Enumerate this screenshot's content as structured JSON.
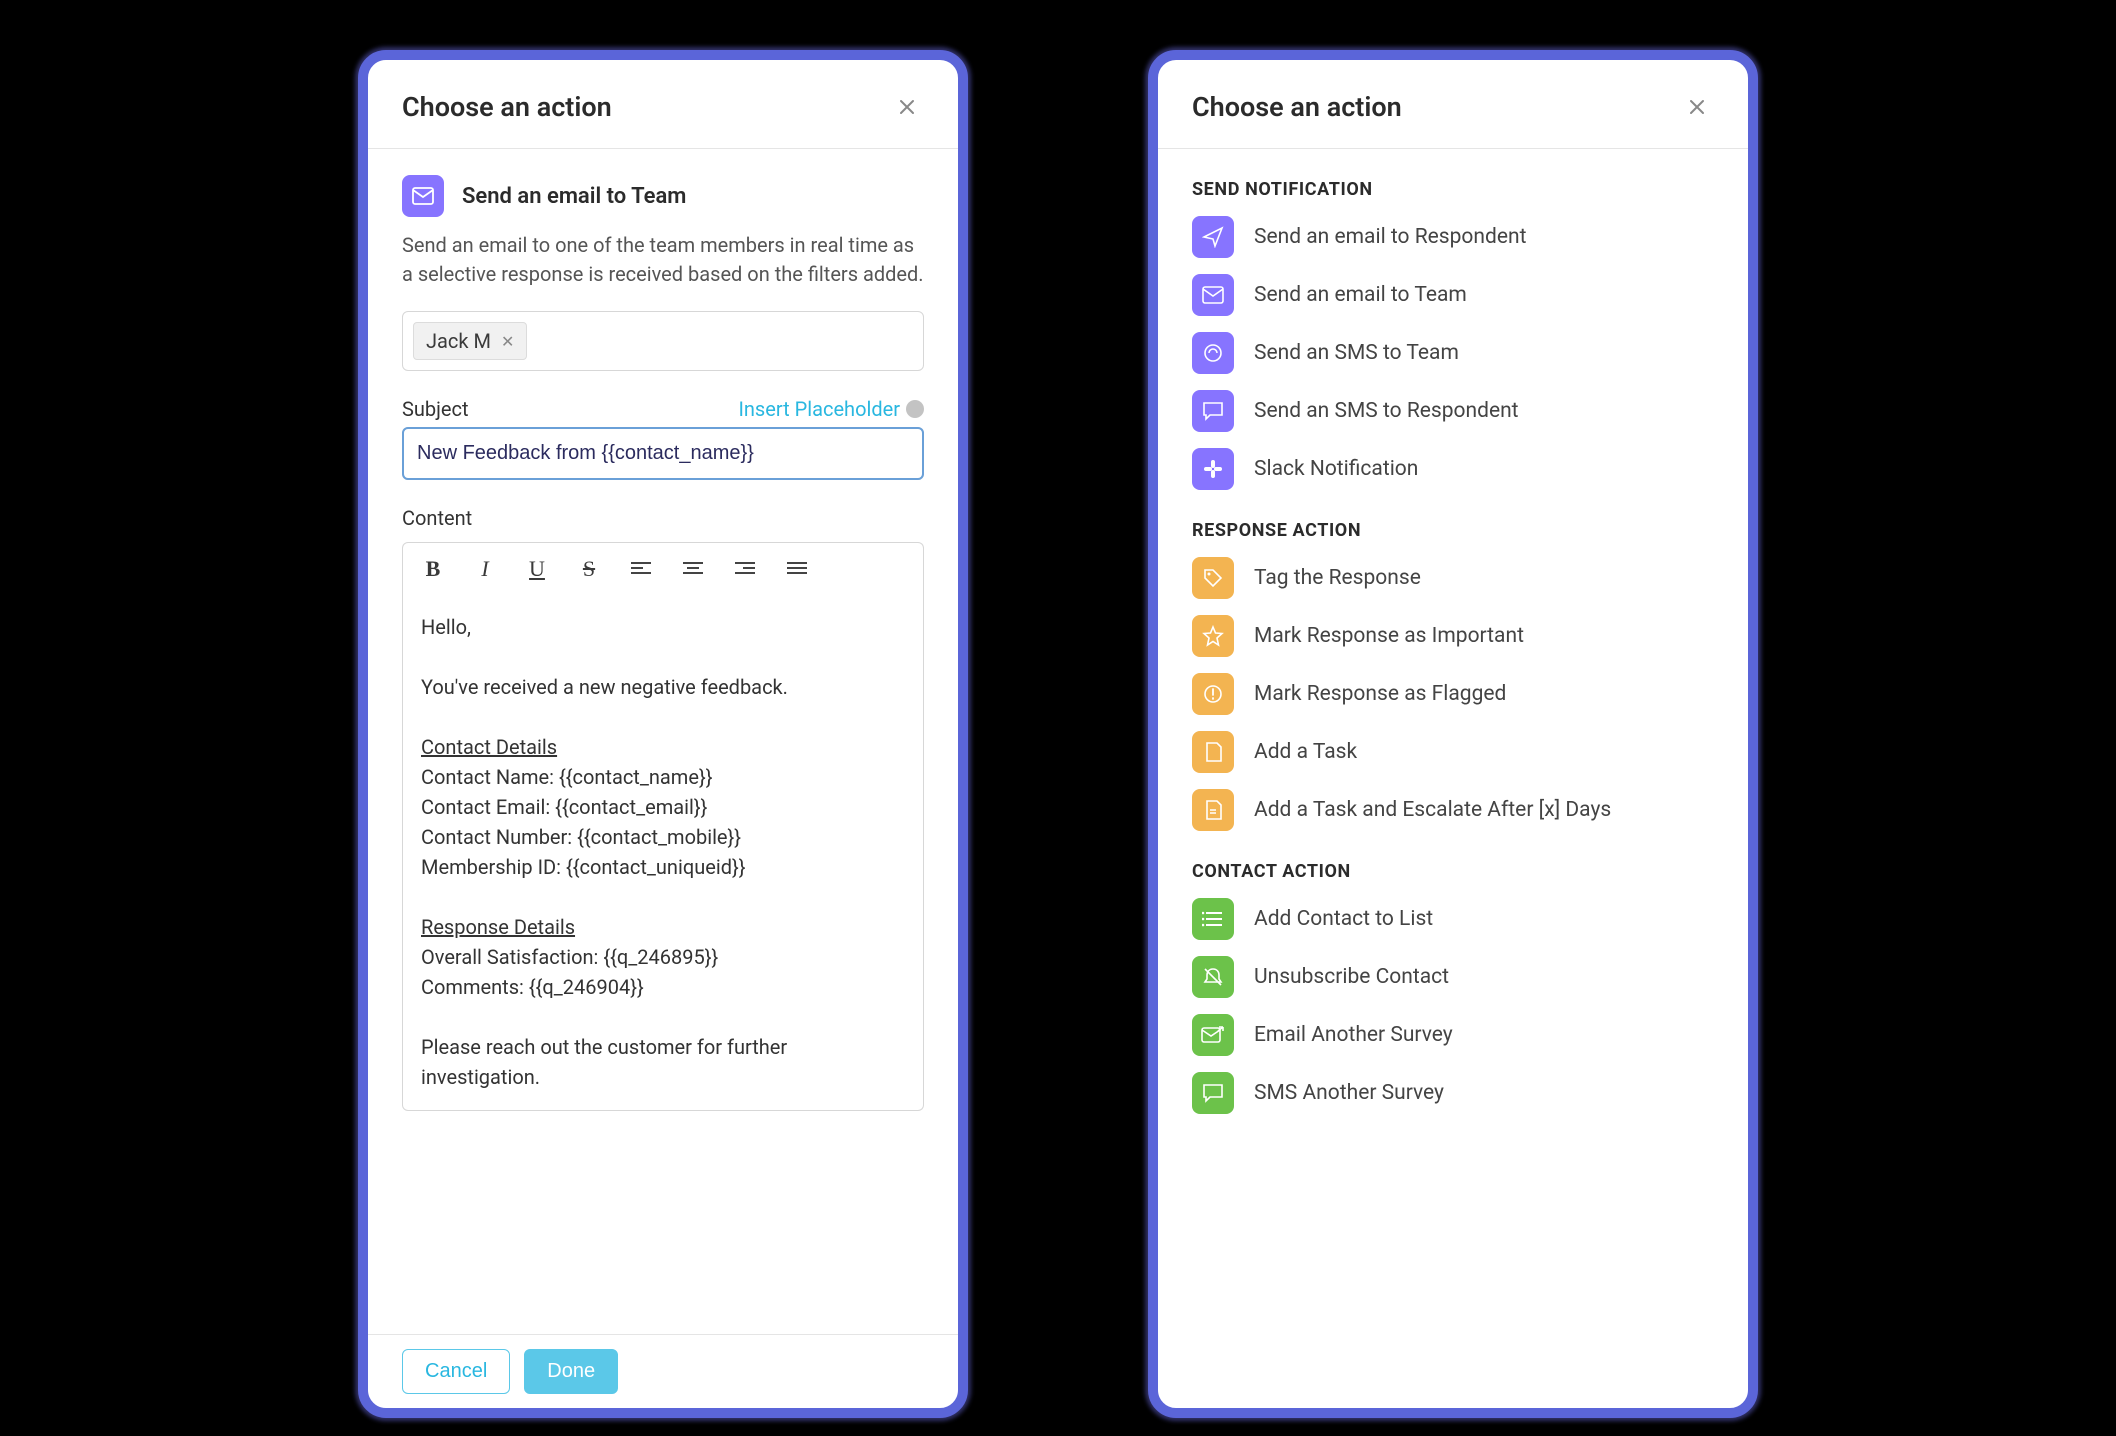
{
  "left": {
    "title": "Choose an action",
    "action_name": "Send an email to Team",
    "description": "Send an email to one of the team members in real time as a selective response is received based on the filters added.",
    "recipients": [
      "Jack M"
    ],
    "subject_label": "Subject",
    "insert_placeholder_label": "Insert Placeholder",
    "subject_value": "New Feedback from {{contact_name}}",
    "content_label": "Content",
    "editor_lines": {
      "greeting": "Hello,",
      "intro": "You've received a new negative feedback.",
      "contact_header": "Contact Details",
      "contact_name": "Contact Name: {{contact_name}}",
      "contact_email": "Contact Email: {{contact_email}}",
      "contact_number": "Contact Number: {{contact_mobile}}",
      "membership": "Membership ID: {{contact_uniqueid}}",
      "response_header": "Response Details",
      "overall": "Overall Satisfaction: {{q_246895}}",
      "comments": "Comments: {{q_246904}}",
      "outro": "Please reach out the customer for further investigation."
    },
    "cancel_label": "Cancel",
    "done_label": "Done"
  },
  "right": {
    "title": "Choose an action",
    "sections": {
      "send_notification": {
        "title": "SEND NOTIFICATION",
        "items": [
          "Send an email to Respondent",
          "Send an email to Team",
          "Send an SMS to Team",
          "Send an SMS to Respondent",
          "Slack Notification"
        ]
      },
      "response_action": {
        "title": "RESPONSE ACTION",
        "items": [
          "Tag the Response",
          "Mark Response as Important",
          "Mark Response as Flagged",
          "Add a Task",
          "Add a Task and Escalate After [x] Days"
        ]
      },
      "contact_action": {
        "title": "CONTACT ACTION",
        "items": [
          "Add Contact to List",
          "Unsubscribe Contact",
          "Email Another Survey",
          "SMS Another Survey"
        ]
      }
    }
  }
}
